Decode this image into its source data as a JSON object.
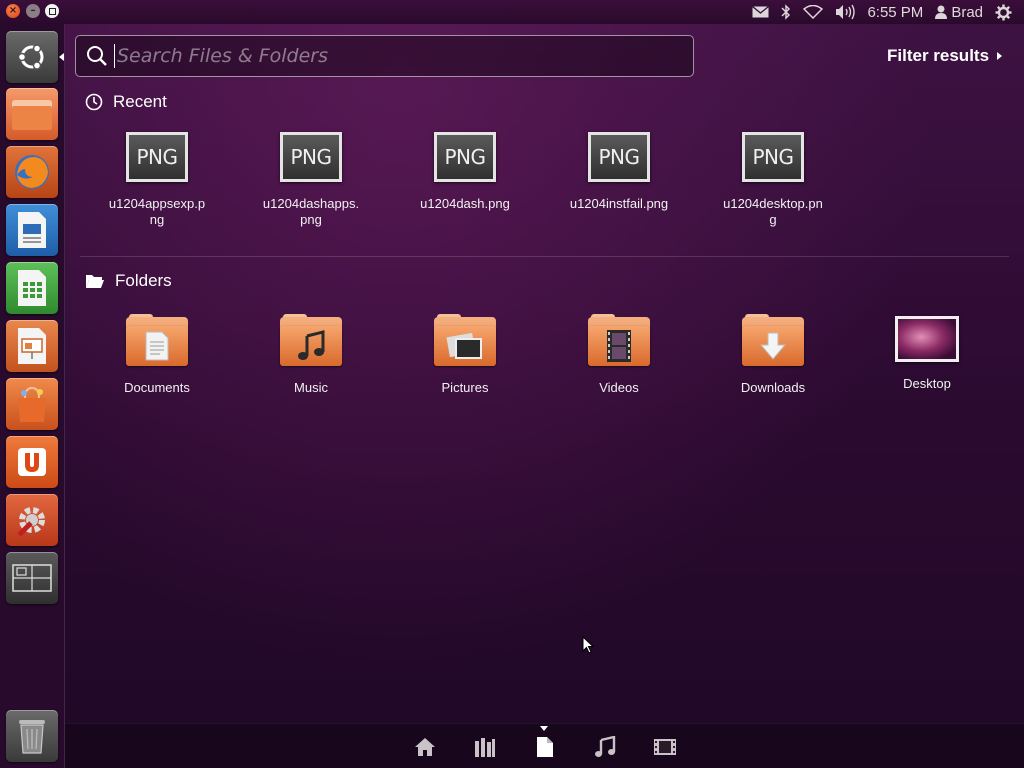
{
  "window_controls": {
    "close": "close-icon",
    "minimize": "minimize-icon",
    "maximize": "maximize-icon"
  },
  "top_panel": {
    "clock": "6:55 PM",
    "user": "Brad",
    "indicators": [
      "mail-icon",
      "bluetooth-icon",
      "wifi-icon",
      "volume-icon",
      "user-icon",
      "gear-icon"
    ]
  },
  "launcher": {
    "items": [
      "dash-home",
      "files",
      "firefox",
      "libreoffice-writer",
      "libreoffice-calc",
      "libreoffice-impress",
      "ubuntu-software-center",
      "ubuntu-one",
      "system-settings",
      "workspace-switcher",
      "trash"
    ]
  },
  "search": {
    "placeholder": "Search Files & Folders",
    "value": ""
  },
  "filter": {
    "label": "Filter results"
  },
  "recent": {
    "heading": "Recent",
    "items": [
      {
        "badge": "PNG",
        "label": "u1204appsexp.png"
      },
      {
        "badge": "PNG",
        "label": "u1204dashapps.png"
      },
      {
        "badge": "PNG",
        "label": "u1204dash.png"
      },
      {
        "badge": "PNG",
        "label": "u1204instfail.png"
      },
      {
        "badge": "PNG",
        "label": "u1204desktop.png"
      }
    ]
  },
  "folders": {
    "heading": "Folders",
    "items": [
      {
        "label": "Documents"
      },
      {
        "label": "Music"
      },
      {
        "label": "Pictures"
      },
      {
        "label": "Videos"
      },
      {
        "label": "Downloads"
      },
      {
        "label": "Desktop"
      }
    ]
  },
  "lenses": {
    "items": [
      "home-lens-icon",
      "applications-lens-icon",
      "files-lens-icon",
      "music-lens-icon",
      "video-lens-icon"
    ],
    "active": "files-lens-icon"
  },
  "colors": {
    "accent": "#dd4814",
    "panel": "#2a0a2c",
    "dash": "#2b0b2e"
  }
}
